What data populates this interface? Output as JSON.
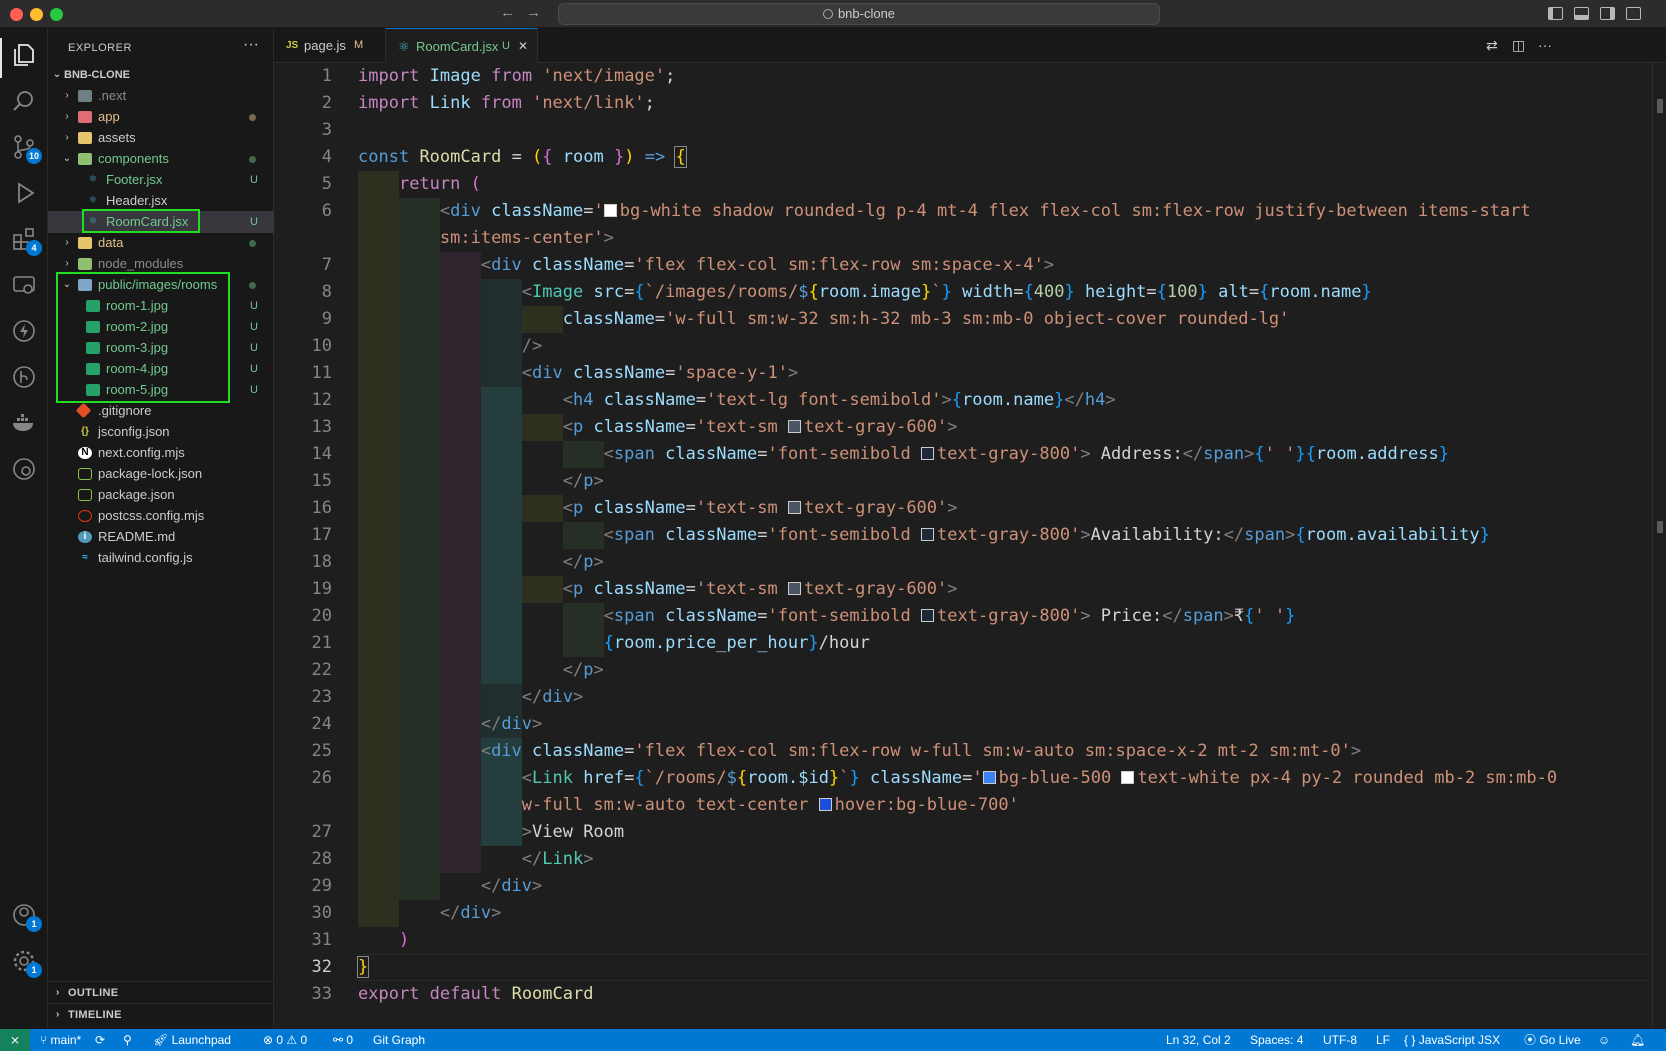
{
  "titlebar": {
    "search_text": "bnb-clone",
    "back_icon": "←",
    "forward_icon": "→"
  },
  "activity_bar": {
    "source_control_badge": "10",
    "extensions_badge": "4",
    "accounts_badge": "1",
    "settings_badge": "1"
  },
  "sidebar": {
    "header": "EXPLORER",
    "more": "···",
    "project": "BNB-CLONE",
    "tree": [
      {
        "name": ".next",
        "deco": ""
      },
      {
        "name": "app",
        "deco": ""
      },
      {
        "name": "assets",
        "deco": ""
      },
      {
        "name": "components",
        "deco": ""
      },
      {
        "name": "Footer.jsx",
        "deco": "U"
      },
      {
        "name": "Header.jsx",
        "deco": ""
      },
      {
        "name": "RoomCard.jsx",
        "deco": "U"
      },
      {
        "name": "data",
        "deco": ""
      },
      {
        "name": "node_modules",
        "deco": ""
      },
      {
        "name": "public/images/rooms",
        "deco": ""
      },
      {
        "name": "room-1.jpg",
        "deco": "U"
      },
      {
        "name": "room-2.jpg",
        "deco": "U"
      },
      {
        "name": "room-3.jpg",
        "deco": "U"
      },
      {
        "name": "room-4.jpg",
        "deco": "U"
      },
      {
        "name": "room-5.jpg",
        "deco": "U"
      },
      {
        "name": ".gitignore",
        "deco": ""
      },
      {
        "name": "jsconfig.json",
        "deco": ""
      },
      {
        "name": "next.config.mjs",
        "deco": ""
      },
      {
        "name": "package-lock.json",
        "deco": ""
      },
      {
        "name": "package.json",
        "deco": ""
      },
      {
        "name": "postcss.config.mjs",
        "deco": ""
      },
      {
        "name": "README.md",
        "deco": ""
      },
      {
        "name": "tailwind.config.js",
        "deco": ""
      }
    ],
    "outline": "OUTLINE",
    "timeline": "TIMELINE"
  },
  "tabs": [
    {
      "label": "page.js",
      "deco": "M",
      "icon": "JS"
    },
    {
      "label": "RoomCard.jsx",
      "deco": "U",
      "icon": "⚛",
      "close": "✕"
    }
  ],
  "editor": {
    "line_numbers": [
      "1",
      "2",
      "3",
      "4",
      "5",
      "6",
      "",
      "7",
      "8",
      "9",
      "10",
      "11",
      "12",
      "13",
      "14",
      "15",
      "16",
      "17",
      "18",
      "19",
      "20",
      "21",
      "22",
      "23",
      "24",
      "25",
      "26",
      "",
      "27",
      "28",
      "29",
      "30",
      "31",
      "32",
      "33"
    ],
    "segments": {
      "import": "import",
      "from": "from",
      "image_name": "Image",
      "link_name": "Link",
      "next_image": "'next/image'",
      "next_link": "'next/link'",
      "semi": ";",
      "const": "const",
      "roomcard": "RoomCard",
      "eq": " = ",
      "lparen": "(",
      "rparen": ")",
      "lbrace": "{",
      "rbrace": "}",
      "room": "room",
      "arrow": "=>",
      "return": "return",
      "lt": "<",
      "gt": ">",
      "close_lt": "</",
      "selfclose": "/>",
      "div": "div",
      "h4": "h4",
      "p": "p",
      "span": "span",
      "link_tag": "Link",
      "image_tag": "Image",
      "classname": "className",
      "src": "src",
      "width": "width",
      "height": "height",
      "alt": "alt",
      "href": "href",
      "eqs": "=",
      "q": "'",
      "bt": "`",
      "l6_str": "bg-white shadow rounded-lg p-4 mt-4 flex flex-col sm:flex-row justify-between items-start",
      "l6b_str": "sm:items-center'",
      "l7_str": "'flex flex-col sm:flex-row sm:space-x-4'",
      "l8_path": "/images/rooms/",
      "dollar": "$",
      "dot_image": ".image",
      "n400": "400",
      "n100": "100",
      "dot_name": ".name",
      "l9_str": "'w-full sm:w-32 sm:h-32 mb-3 sm:mb-0 object-cover rounded-lg'",
      "l11_str": "'space-y-1'",
      "l12_str": "'text-lg font-semibold'",
      "textsm": "text-sm ",
      "gray600": "text-gray-600'",
      "fontsemi": "font-semibold ",
      "gray800": "text-gray-800'",
      "address": " Address:",
      "space_str": "' '",
      "dot_address": ".address",
      "availability": "Availability:",
      "dot_availability": ".availability",
      "price": " Price:",
      "rupee": "₹",
      "dot_price": ".price_per_hour",
      "hour": "/hour",
      "l25_str": "'flex flex-col sm:flex-row w-full sm:w-auto sm:space-x-2 mt-2 sm:mt-0'",
      "l26_path": "/rooms/",
      "dot_id": ".$id",
      "blue500": "bg-blue-500 ",
      "white_text": "text-white px-4 py-2 rounded mb-2 sm:mb-0",
      "l26b_str": "w-full sm:w-auto text-center ",
      "hover": "hover:bg-blue-700'",
      "view_room": "View Room",
      "export": "export",
      "default": "default"
    }
  },
  "statusbar": {
    "branch": "main*",
    "launchpad": "Launchpad",
    "errors": "0",
    "warnings": "0",
    "ports": "0",
    "git_graph": "Git Graph",
    "position": "Ln 32, Col 2",
    "spaces": "Spaces: 4",
    "encoding": "UTF-8",
    "eol": "LF",
    "language": "JavaScript JSX",
    "golive": "Go Live",
    "lang_braces": "{ }"
  },
  "colors": {
    "accent": "#0078d4",
    "highlight_box": "#22dd22"
  }
}
